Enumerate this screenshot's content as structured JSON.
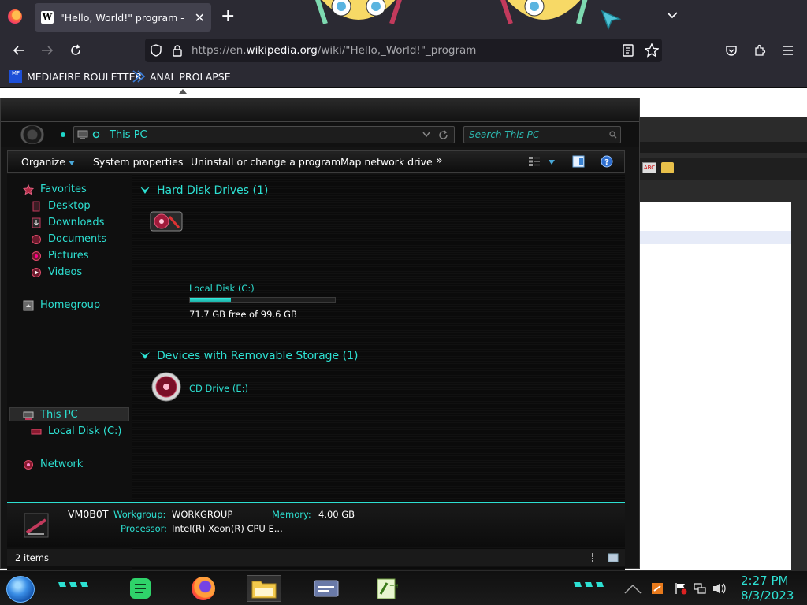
{
  "browser": {
    "tab_title": "\"Hello, World!\" program - Wikipedia",
    "tab_close": "✕",
    "new_tab": "+",
    "list_tabs": "⌄",
    "url_prefix": "https://en.",
    "url_host": "wikipedia.org",
    "url_path": "/wiki/\"Hello,_World!\"_program",
    "bookmarks": [
      {
        "label": "MEDIAFIRE ROULETTER",
        "icon": "MF"
      },
      {
        "label": "ANAL PROLAPSE",
        "icon": ""
      }
    ],
    "colors": {
      "toolbar": "#2b2a33",
      "urlbar": "#1c1b22"
    }
  },
  "explorer": {
    "address": "This PC",
    "search_placeholder": "Search This PC",
    "toolbar": {
      "organize": "Organize",
      "system_properties": "System properties",
      "uninstall": "Uninstall or change a program",
      "map_drive": "Map network drive",
      "more": "»"
    },
    "nav": {
      "favorites": "Favorites",
      "desktop": "Desktop",
      "downloads": "Downloads",
      "documents": "Documents",
      "pictures": "Pictures",
      "videos": "Videos",
      "homegroup": "Homegroup",
      "this_pc": "This PC",
      "local_disk": "Local Disk (C:)",
      "network": "Network"
    },
    "groups": {
      "hard_disks": "Hard Disk Drives (1)",
      "removable": "Devices with Removable Storage (1)"
    },
    "drives": {
      "c_name": "Local Disk (C:)",
      "c_free": "71.7 GB free of 99.6 GB",
      "c_used_fraction": 0.28,
      "e_name": "CD Drive (E:)"
    },
    "details": {
      "computer_name": "VM0B0T",
      "workgroup_label": "Workgroup:",
      "workgroup_value": "WORKGROUP",
      "memory_label": "Memory:",
      "memory_value": "4.00 GB",
      "processor_label": "Processor:",
      "processor_value": "Intel(R) Xeon(R) CPU E..."
    },
    "status": "2 items",
    "colors": {
      "accent": "#2de0d2",
      "background": "#141414"
    }
  },
  "taskbar": {
    "time": "2:27 PM",
    "date": "8/3/2023"
  }
}
